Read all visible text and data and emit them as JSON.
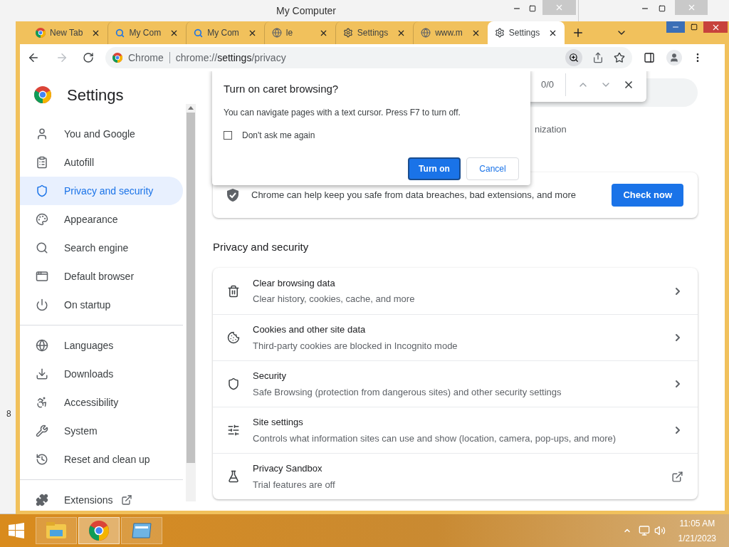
{
  "background_window": {
    "title": "My Computer",
    "side_text": "8"
  },
  "browser": {
    "tabs": [
      {
        "title": "New Tab",
        "kind": "chrome",
        "selected": false
      },
      {
        "title": "My Com",
        "kind": "search",
        "selected": false
      },
      {
        "title": "My Com",
        "kind": "search",
        "selected": false
      },
      {
        "title": "le",
        "kind": "globe",
        "selected": false
      },
      {
        "title": "Settings",
        "kind": "gear",
        "selected": false
      },
      {
        "title": "www.m",
        "kind": "globe",
        "selected": false
      },
      {
        "title": "Settings",
        "kind": "gear",
        "selected": true
      }
    ],
    "omnibox": {
      "site": "Chrome",
      "url_pre": "chrome://",
      "url_host": "settings",
      "url_post": "/privacy"
    }
  },
  "settings": {
    "title": "Settings",
    "nav": [
      {
        "label": "You and Google",
        "selected": false
      },
      {
        "label": "Autofill",
        "selected": false
      },
      {
        "label": "Privacy and security",
        "selected": true
      },
      {
        "label": "Appearance",
        "selected": false
      },
      {
        "label": "Search engine",
        "selected": false
      },
      {
        "label": "Default browser",
        "selected": false
      },
      {
        "label": "On startup",
        "selected": false
      },
      {
        "label": "Languages",
        "selected": false
      },
      {
        "label": "Downloads",
        "selected": false
      },
      {
        "label": "Accessibility",
        "selected": false
      },
      {
        "label": "System",
        "selected": false
      },
      {
        "label": "Reset and clean up",
        "selected": false
      }
    ],
    "extensions": "Extensions",
    "partial_text": "nization",
    "safety_check": {
      "text": "Chrome can help keep you safe from data breaches, bad extensions, and more",
      "button": "Check now"
    },
    "section_title": "Privacy and security",
    "rows": [
      {
        "title": "Clear browsing data",
        "subtitle": "Clear history, cookies, cache, and more",
        "kind": "page"
      },
      {
        "title": "Cookies and other site data",
        "subtitle": "Third-party cookies are blocked in Incognito mode",
        "kind": "page"
      },
      {
        "title": "Security",
        "subtitle": "Safe Browsing (protection from dangerous sites) and other security settings",
        "kind": "page"
      },
      {
        "title": "Site settings",
        "subtitle": "Controls what information sites can use and show (location, camera, pop-ups, and more)",
        "kind": "page"
      },
      {
        "title": "Privacy Sandbox",
        "subtitle": "Trial features are off",
        "kind": "external"
      }
    ]
  },
  "find_bar": {
    "count": "0/0"
  },
  "dialog": {
    "title": "Turn on caret browsing?",
    "message": "You can navigate pages with a text cursor. Press F7 to turn off.",
    "checkbox": {
      "label": "Don't ask me again",
      "checked": false
    },
    "primary": "Turn on",
    "secondary": "Cancel"
  },
  "taskbar": {
    "apps": [
      {
        "kind": "explorer",
        "selected": false
      },
      {
        "kind": "chrome",
        "selected": true
      },
      {
        "kind": "window",
        "selected": false
      }
    ],
    "time": "11:05 AM",
    "date": "1/21/2023"
  }
}
